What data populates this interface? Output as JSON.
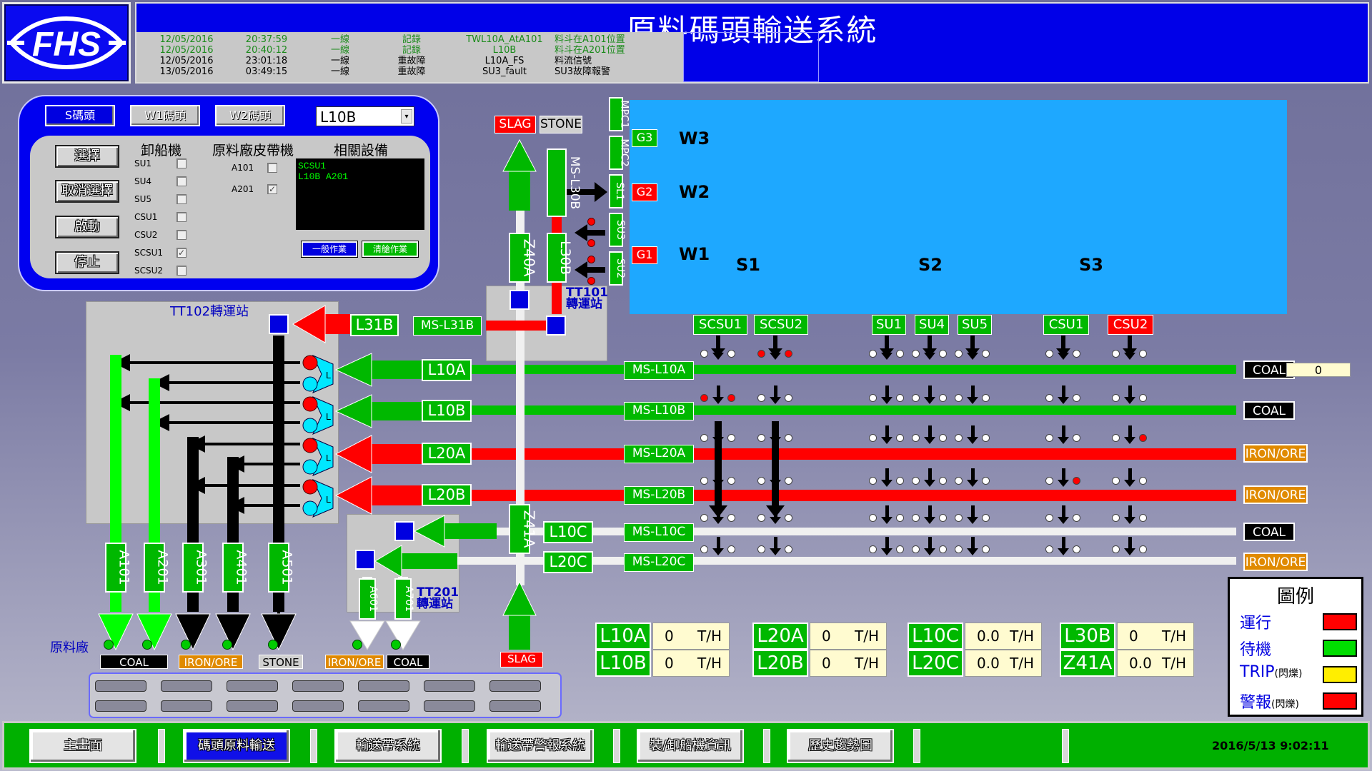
{
  "header": {
    "logo_text": "FHS",
    "title": "原料碼頭輸送系統",
    "alarm_log": [
      [
        "12/05/2016",
        "20:37:59",
        "一線",
        "記錄",
        "TWL10A_AtA101",
        "料斗在A101位置"
      ],
      [
        "12/05/2016",
        "20:40:12",
        "一線",
        "記錄",
        "L10B",
        "料斗在A201位置"
      ],
      [
        "12/05/2016",
        "23:01:18",
        "一線",
        "重故障",
        "L10A_FS",
        "料流信號"
      ],
      [
        "13/05/2016",
        "03:49:15",
        "一線",
        "重故障",
        "SU3_fault",
        "SU3故障報警"
      ]
    ]
  },
  "control_panel": {
    "tabs": [
      "S碼頭",
      "W1碼頭",
      "W2碼頭"
    ],
    "selected_line": "L10B",
    "buttons": [
      "選擇",
      "取消選擇",
      "啟動",
      "停止"
    ],
    "col_unloaders": "卸船機",
    "col_belts": "原料廠皮帶機",
    "col_equipment": "相關設備",
    "unloaders": [
      {
        "name": "SU1",
        "checked": ""
      },
      {
        "name": "SU4",
        "checked": ""
      },
      {
        "name": "SU5",
        "checked": ""
      },
      {
        "name": "CSU1",
        "checked": ""
      },
      {
        "name": "CSU2",
        "checked": ""
      },
      {
        "name": "SCSU1",
        "checked": "✓"
      },
      {
        "name": "SCSU2",
        "checked": ""
      }
    ],
    "belts": [
      {
        "name": "A101",
        "checked": ""
      },
      {
        "name": "A201",
        "checked": "✓"
      }
    ],
    "equipment_text": "SCSU1\nL10B A201",
    "mode_normal": "一般作業",
    "mode_clean": "清艙作業"
  },
  "process": {
    "tt102_label": "TT102轉運站",
    "tt101_label": "TT101\n轉運站",
    "tt201_label": "TT201\n轉運站",
    "slag": "SLAG",
    "stone": "STONE",
    "berths": [
      "W3",
      "W2",
      "W1"
    ],
    "gates": [
      "G3",
      "G2",
      "G1"
    ],
    "sections": [
      "S1",
      "S2",
      "S3"
    ],
    "right_vert_tags": [
      "MPC1",
      "MPC2",
      "SL1",
      "SU3",
      "SU2"
    ],
    "ms_l30b": "MS-L30B",
    "l30b": "L30B",
    "z40a": "Z40A",
    "z41a": "Z41A",
    "l31b": "L31B",
    "ms_l31b": "MS-L31B",
    "unloaders": [
      "SCSU1",
      "SCSU2",
      "SU1",
      "SU4",
      "SU5",
      "CSU1",
      "CSU2"
    ],
    "lines": [
      {
        "name": "L10A",
        "ms": "MS-L10A",
        "material": "COAL",
        "value": "0"
      },
      {
        "name": "L10B",
        "ms": "MS-L10B",
        "material": "COAL"
      },
      {
        "name": "L20A",
        "ms": "MS-L20A",
        "material": "IRON/ORE"
      },
      {
        "name": "L20B",
        "ms": "MS-L20B",
        "material": "IRON/ORE"
      },
      {
        "name": "L10C",
        "ms": "MS-L10C",
        "material": "COAL"
      },
      {
        "name": "L20C",
        "ms": "MS-L20C",
        "material": "IRON/ORE"
      }
    ],
    "switch_label": "L",
    "plant_label": "原料廠",
    "out_belts": [
      "A101",
      "A201",
      "A301",
      "A401",
      "A501",
      "A601",
      "A701"
    ],
    "out_mats": [
      "COAL",
      "IRON/ORE",
      "STONE",
      "IRON/ORE",
      "COAL",
      "SLAG"
    ]
  },
  "throughput": [
    [
      {
        "name": "L10A",
        "val": "0",
        "unit": "T/H"
      },
      {
        "name": "L10B",
        "val": "0",
        "unit": "T/H"
      }
    ],
    [
      {
        "name": "L20A",
        "val": "0",
        "unit": "T/H"
      },
      {
        "name": "L20B",
        "val": "0",
        "unit": "T/H"
      }
    ],
    [
      {
        "name": "L10C",
        "val": "0.0",
        "unit": "T/H"
      },
      {
        "name": "L20C",
        "val": "0.0",
        "unit": "T/H"
      }
    ],
    [
      {
        "name": "L30B",
        "val": "0",
        "unit": "T/H"
      },
      {
        "name": "Z41A",
        "val": "0.0",
        "unit": "T/H"
      }
    ]
  ],
  "legend": {
    "title": "圖例",
    "items": [
      {
        "label": "運行",
        "note": "",
        "color": "#ff0000"
      },
      {
        "label": "待機",
        "note": "",
        "color": "#00dd00"
      },
      {
        "label": "TRIP",
        "note": "(閃爍)",
        "color": "#ffee00"
      },
      {
        "label": "警報",
        "note": "(閃爍)",
        "color": "#ff0000"
      }
    ]
  },
  "nav": {
    "buttons": [
      "主畫面",
      "碼頭原料輸送",
      "輸送帶系統",
      "輸送帶警報系統",
      "裝/卸船機資訊",
      "歷史趨勢圖"
    ],
    "active_index": 1,
    "datetime": "2016/5/13 9:02:11"
  },
  "colors": {
    "running": "#ff0000",
    "standby": "#00b800",
    "header_blue": "#0000e8",
    "berth": "#1ea8ff",
    "belt_white": "#f0f0f0"
  }
}
